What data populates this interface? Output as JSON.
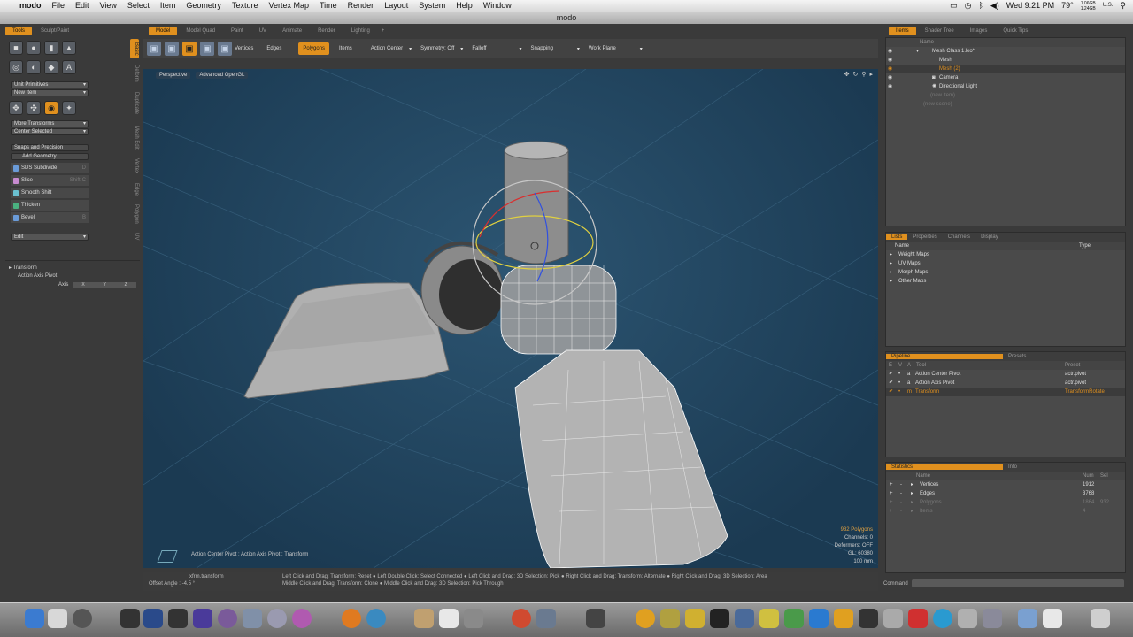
{
  "menubar": {
    "apple": "",
    "app": "modo",
    "items": [
      "File",
      "Edit",
      "View",
      "Select",
      "Item",
      "Geometry",
      "Texture",
      "Vertex Map",
      "Time",
      "Render",
      "Layout",
      "System",
      "Help",
      "Window"
    ],
    "right": {
      "clock": "Wed 9:21 PM",
      "temp": "79°",
      "mem1": "1.06GB",
      "mem2": "1.24GB",
      "locale": "U.S."
    }
  },
  "window": {
    "title": "modo"
  },
  "left_tabs": [
    "Tools",
    "Sculpt/Paint"
  ],
  "main_tabs": [
    "Model",
    "Model Quad",
    "Paint",
    "UV",
    "Animate",
    "Render",
    "Lighting"
  ],
  "add_tab": "+",
  "right_tabs": [
    "Items",
    "Shader Tree",
    "Images",
    "Quick Tips"
  ],
  "left": {
    "unit_primitives": "Unit Primitives",
    "new_item": "New Item",
    "more_transforms": "More Transforms",
    "center_selected": "Center Selected",
    "snaps": "Snaps and Precision",
    "add_geometry": "Add Geometry",
    "geo": [
      {
        "label": "SDS Subdivide",
        "shortcut": "D",
        "color": "#6a9bd8"
      },
      {
        "label": "Slice",
        "shortcut": "Shift-C",
        "color": "#c88bd0"
      },
      {
        "label": "Smooth Shift",
        "shortcut": "",
        "color": "#6ac0d0"
      },
      {
        "label": "Thicken",
        "shortcut": "",
        "color": "#4ab080"
      },
      {
        "label": "Bevel",
        "shortcut": "B",
        "color": "#6a9bd8"
      }
    ],
    "edit": "Edit",
    "transform": "Transform",
    "action_axis_pivot": "Action Axis Pivot",
    "axis": "Axis",
    "axis_x": "X",
    "axis_y": "Y",
    "axis_z": "Z",
    "vtabs": [
      "Basic",
      "Deform",
      "Duplicate",
      "Mesh Edit",
      "Vertex",
      "Edge",
      "Polygon",
      "UV"
    ]
  },
  "toolbar": {
    "vertices": "Vertices",
    "edges": "Edges",
    "polygons": "Polygons",
    "items": "Items",
    "action_center": "Action Center",
    "symmetry": "Symmetry: Off",
    "falloff": "Falloff",
    "snapping": "Snapping",
    "work_plane": "Work Plane"
  },
  "viewport": {
    "view": "Perspective",
    "shading": "Advanced OpenGL",
    "polygons": "932 Polygons",
    "channels": "Channels: 0",
    "deformers": "Deformers: OFF",
    "gl": "GL: 60380",
    "scale": "100 mm",
    "bottom": "Action Center Pivot : Action Axis Pivot : Transform"
  },
  "status": {
    "tool": "xfrm.transform",
    "offset": "Offset Angle : -4.5 °",
    "line1": "Left Click and Drag: Transform: Reset ● Left Double Click: Select Connected ● Left Click and Drag: 3D Selection: Pick ● Right Click and Drag: Transform: Alternate ● Right Click and Drag: 3D Selection: Area",
    "line2": "Middle Click and Drag: Transform: Clone ● Middle Click and Drag: 3D Selection: Pick Through"
  },
  "items": {
    "col": "Name",
    "rows": [
      {
        "label": "Mesh Class 1.lxo*",
        "indent": 22,
        "sel": false
      },
      {
        "label": "Mesh",
        "indent": 30,
        "sel": false
      },
      {
        "label": "Mesh (2)",
        "indent": 30,
        "sel": true
      },
      {
        "label": "Camera",
        "indent": 30,
        "sel": false
      },
      {
        "label": "Directional Light",
        "indent": 30,
        "sel": false
      }
    ],
    "dim": [
      "(new item)",
      "(new scene)"
    ]
  },
  "lists": {
    "tabs": [
      "Lists",
      "Properties",
      "Channels",
      "Display"
    ],
    "col_name": "Name",
    "col_type": "Type",
    "rows": [
      "Weight Maps",
      "UV Maps",
      "Morph Maps",
      "Other Maps"
    ]
  },
  "pipeline": {
    "tabs": [
      "Pipeline",
      "Presets"
    ],
    "cols": [
      "E",
      "V",
      "A",
      "Tool",
      "Preset"
    ],
    "rows": [
      {
        "a": "a",
        "tool": "Action Center Pivot",
        "preset": "actr.pivot",
        "sel": false
      },
      {
        "a": "a",
        "tool": "Action Axis Pivot",
        "preset": "actr.pivot",
        "sel": false
      },
      {
        "a": "m",
        "tool": "Transform",
        "preset": "TransformRotate",
        "sel": true
      }
    ]
  },
  "statistics": {
    "tabs": [
      "Statistics",
      "Info"
    ],
    "cols": [
      "Name",
      "Num",
      "Sel"
    ],
    "rows": [
      {
        "name": "Vertices",
        "num": "1912",
        "sel": "",
        "dim": false
      },
      {
        "name": "Edges",
        "num": "3768",
        "sel": "",
        "dim": false
      },
      {
        "name": "Polygons",
        "num": "1864",
        "sel": "932",
        "dim": true
      },
      {
        "name": "Items",
        "num": "4",
        "sel": "",
        "dim": true
      }
    ]
  },
  "command": {
    "label": "Command"
  }
}
